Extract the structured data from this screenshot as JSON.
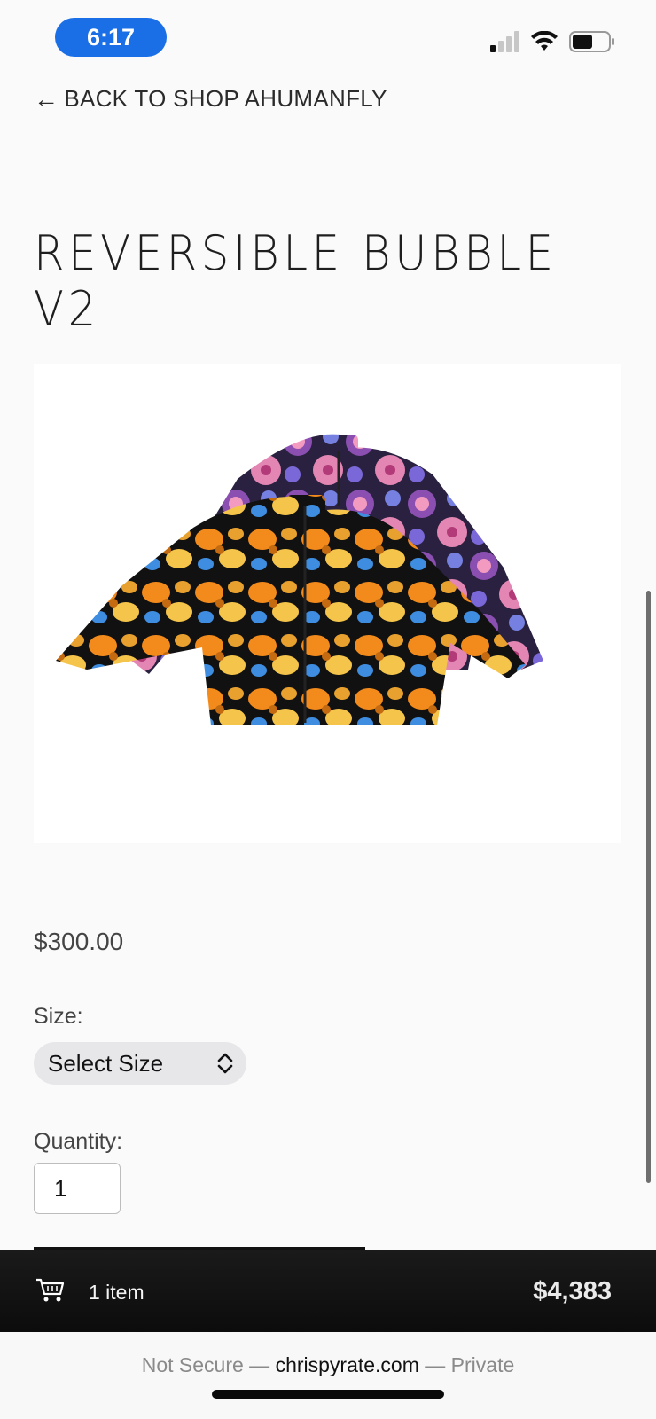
{
  "status_bar": {
    "time": "6:17",
    "signal_icon": "signal-icon",
    "wifi_icon": "wifi-icon",
    "battery_icon": "battery-icon"
  },
  "nav": {
    "back_arrow": "←",
    "back_label": "BACK TO SHOP AHUMANFLY"
  },
  "product": {
    "title": "REVERSIBLE BUBBLE V2",
    "image_alt": "reversible puffer jacket - orange koi fish print and purple floral print",
    "price": "$300.00",
    "size_label": "Size:",
    "size_select_value": "Select Size",
    "quantity_label": "Quantity:",
    "quantity_value": "1"
  },
  "cart": {
    "icon": "cart-icon",
    "count_label": "1 item",
    "total": "$4,383"
  },
  "browser": {
    "prefix": "Not Secure —",
    "domain": "chrispyrate.com",
    "suffix": "— Private"
  }
}
